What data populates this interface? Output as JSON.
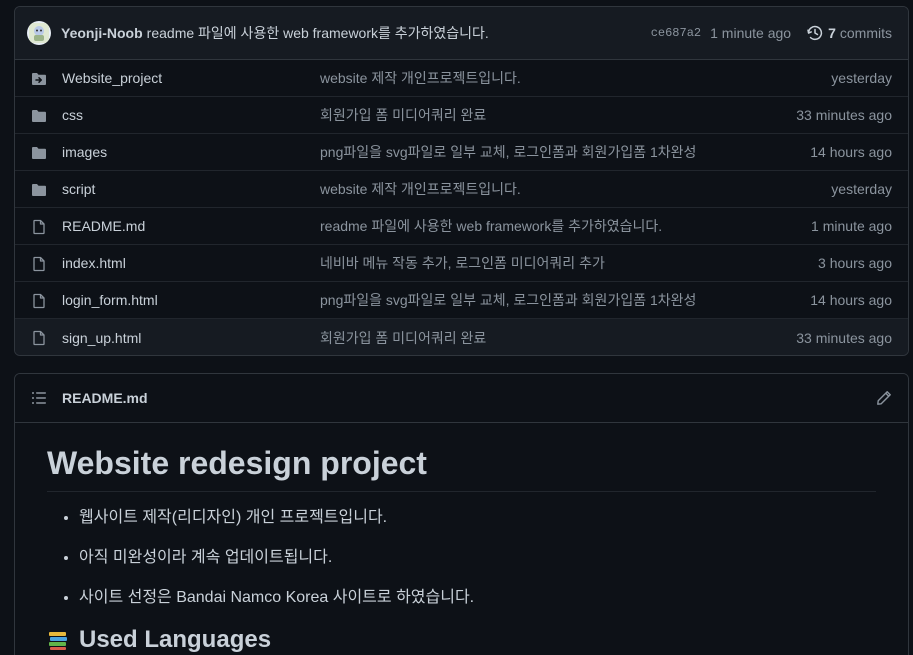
{
  "commit": {
    "author": "Yeonji-Noob",
    "message": "readme 파일에 사용한 web framework를 추가하였습니다.",
    "sha": "ce687a2",
    "time": "1 minute ago",
    "commits_count": "7",
    "commits_label": "commits"
  },
  "files": [
    {
      "name": "Website_project",
      "type": "submodule",
      "commit": "website 제작 개인프로젝트입니다.",
      "age": "yesterday"
    },
    {
      "name": "css",
      "type": "folder",
      "commit": "회원가입 폼 미디어쿼리 완료",
      "age": "33 minutes ago"
    },
    {
      "name": "images",
      "type": "folder",
      "commit": "png파일을 svg파일로 일부 교체, 로그인폼과 회원가입폼 1차완성",
      "age": "14 hours ago"
    },
    {
      "name": "script",
      "type": "folder",
      "commit": "website 제작 개인프로젝트입니다.",
      "age": "yesterday"
    },
    {
      "name": "README.md",
      "type": "file",
      "commit": "readme 파일에 사용한 web framework를 추가하였습니다.",
      "age": "1 minute ago"
    },
    {
      "name": "index.html",
      "type": "file",
      "commit": "네비바 메뉴 작동 추가, 로그인폼 미디어쿼리 추가",
      "age": "3 hours ago"
    },
    {
      "name": "login_form.html",
      "type": "file",
      "commit": "png파일을 svg파일로 일부 교체, 로그인폼과 회원가입폼 1차완성",
      "age": "14 hours ago"
    },
    {
      "name": "sign_up.html",
      "type": "file",
      "commit": "회원가입 폼 미디어쿼리 완료",
      "age": "33 minutes ago"
    }
  ],
  "readme": {
    "filename": "README.md",
    "h1": "Website redesign project",
    "bullets": [
      "웹사이트 제작(리디자인) 개인 프로젝트입니다.",
      "아직 미완성이라 계속 업데이트됩니다.",
      "사이트 선정은 Bandai Namco Korea 사이트로 하였습니다."
    ],
    "h2": "Used Languages"
  },
  "colors": {
    "background": "#0d1117",
    "header_bg": "#161b22",
    "border": "#30363d",
    "text": "#c9d1d9",
    "muted": "#8b949e",
    "icon": "#8b949e"
  }
}
